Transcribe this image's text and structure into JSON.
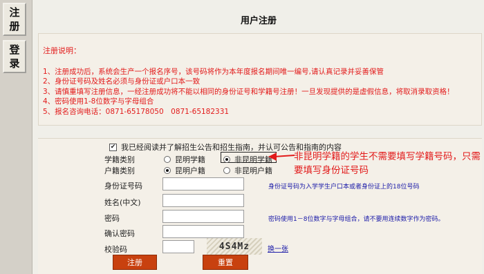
{
  "nav": {
    "register": "注册",
    "login": "登录"
  },
  "page": {
    "title": "用户注册"
  },
  "notice": {
    "title": "注册说明：",
    "lines": [
      "1、注册成功后，系统会生产一个报名序号，该号码将作为本年度报名期间唯一编号,请认真记录并妥善保管",
      "2、身份证号码及姓名必须与身份证或户口本一致",
      "3、请慎重填写注册信息，一经注册成功将不能以相同的身份证号和学籍号注册！一旦发现提供的是虚假信息，将取消录取资格！",
      "4、密码使用1-8位数字与字母组合",
      "5、报名咨询电话：0871-65178050　0871-65182331"
    ]
  },
  "form": {
    "agree_label": "我已经阅读并了解招生公告和招生指南，并认可公告和指南的内容",
    "agree_checked": true,
    "student_type": {
      "label": "学籍类别",
      "options": [
        "昆明学籍",
        "非昆明学籍"
      ],
      "selected": "非昆明学籍"
    },
    "household_type": {
      "label": "户籍类别",
      "options": [
        "昆明户籍",
        "非昆明户籍"
      ],
      "selected": "昆明户籍"
    },
    "id_label": "身份证号码",
    "id_value": "",
    "id_hint": "身份证号码为入学学生户口本或者身份证上的18位号码",
    "name_label": "姓名(中文)",
    "name_value": "",
    "password_label": "密码",
    "password_value": "",
    "password_hint": "密码使用1－8位数字与字母组合，请不要用连续数字作为密码。",
    "confirm_label": "确认密码",
    "confirm_value": "",
    "captcha_label": "校验码",
    "captcha_value": "",
    "captcha_text": "4S4Mz",
    "captcha_refresh": "换一张",
    "submit_label": "注册",
    "reset_label": "重置"
  },
  "annotation": {
    "text": "非昆明学籍的学生不需要填写学籍号码，只需要填写身份证号码",
    "color": "#e21a1a"
  },
  "colors": {
    "notice_text": "#e21a1a",
    "hint_text": "#1a1aa8",
    "button_bg": "#c8410f"
  }
}
